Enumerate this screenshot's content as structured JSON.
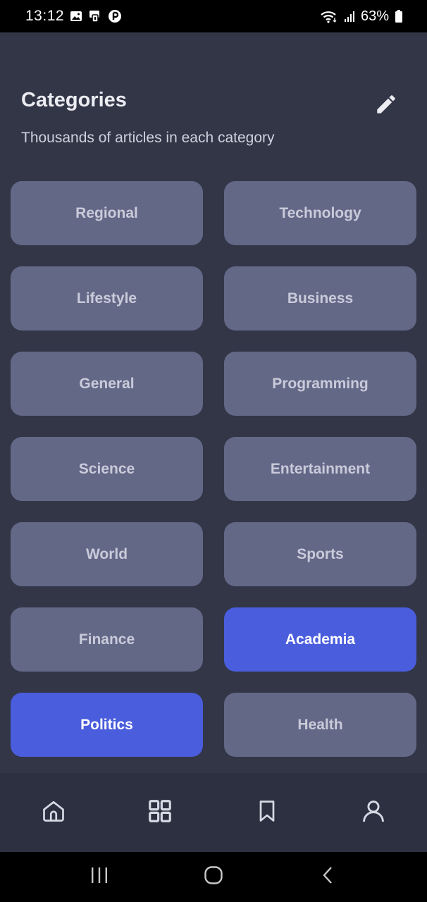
{
  "status_bar": {
    "time": "13:12",
    "icons": [
      "image-icon",
      "notification-icon",
      "opera-icon"
    ],
    "right_icons": [
      "wifi-icon",
      "signal-icon",
      "battery-icon"
    ],
    "battery": "63%"
  },
  "header": {
    "title": "Categories",
    "subtitle": "Thousands of articles in each category",
    "edit_icon": "pencil-icon"
  },
  "categories": [
    {
      "label": "Regional",
      "selected": false
    },
    {
      "label": "Technology",
      "selected": false
    },
    {
      "label": "Lifestyle",
      "selected": false
    },
    {
      "label": "Business",
      "selected": false
    },
    {
      "label": "General",
      "selected": false
    },
    {
      "label": "Programming",
      "selected": false
    },
    {
      "label": "Science",
      "selected": false
    },
    {
      "label": "Entertainment",
      "selected": false
    },
    {
      "label": "World",
      "selected": false
    },
    {
      "label": "Sports",
      "selected": false
    },
    {
      "label": "Finance",
      "selected": false
    },
    {
      "label": "Academia",
      "selected": true
    },
    {
      "label": "Politics",
      "selected": true
    },
    {
      "label": "Health",
      "selected": false
    }
  ],
  "bottom_nav": {
    "items": [
      "home-icon",
      "grid-icon",
      "bookmark-icon",
      "profile-icon"
    ],
    "active": "grid-icon"
  },
  "system_nav": {
    "items": [
      "recents-icon",
      "home-circle-icon",
      "back-icon"
    ]
  },
  "colors": {
    "background": "#323647",
    "tile": "#646887",
    "tile_selected": "#4a5ddc",
    "nav_background": "#2c3040",
    "icon": "#d6d8e4"
  }
}
